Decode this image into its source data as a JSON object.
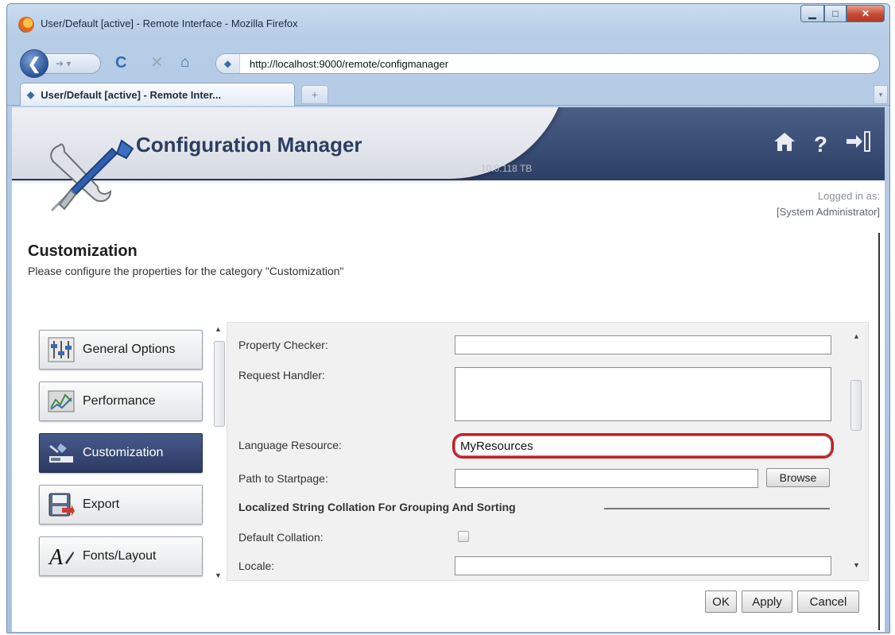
{
  "browser": {
    "window_title": "User/Default [active] - Remote Interface - Mozilla Firefox",
    "url": "http://localhost:9000/remote/configmanager",
    "tab_title": "User/Default [active] - Remote Inter...",
    "new_tab_label": "+"
  },
  "app": {
    "title": "Configuration Manager",
    "version": "10.0.118 TB",
    "logged_in_label": "Logged in as:",
    "logged_in_user": "[System Administrator]"
  },
  "section": {
    "title": "Customization",
    "description": "Please configure the properties for the category \"Customization\""
  },
  "nav": {
    "items": [
      {
        "label": "General Options",
        "icon": "sliders-icon",
        "active": false
      },
      {
        "label": "Performance",
        "icon": "chart-icon",
        "active": false
      },
      {
        "label": "Customization",
        "icon": "wrench-icon",
        "active": true
      },
      {
        "label": "Export",
        "icon": "floppy-export-icon",
        "active": false
      },
      {
        "label": "Fonts/Layout",
        "icon": "font-icon",
        "active": false
      }
    ]
  },
  "properties": {
    "property_checker": {
      "label": "Property Checker:",
      "value": ""
    },
    "request_handler": {
      "label": "Request Handler:",
      "value": ""
    },
    "language_resource": {
      "label": "Language Resource:",
      "value": "MyResources"
    },
    "path_to_startpage": {
      "label": "Path to Startpage:",
      "value": "",
      "browse_label": "Browse"
    },
    "group_title": "Localized String Collation For Grouping And Sorting",
    "default_collation": {
      "label": "Default Collation:",
      "checked": false
    },
    "locale": {
      "label": "Locale:",
      "value": ""
    }
  },
  "buttons": {
    "ok": "OK",
    "apply": "Apply",
    "cancel": "Cancel"
  },
  "colors": {
    "header_dark": "#2c3f66",
    "active_nav": "#34446f",
    "highlight": "#c91f25"
  }
}
